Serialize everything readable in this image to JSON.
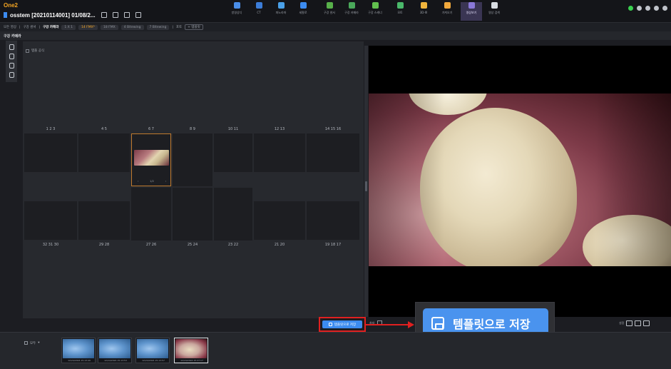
{
  "app": {
    "brand": "One2"
  },
  "patient": {
    "header": "osstem [20210114001] 01/08/2..."
  },
  "nav": [
    {
      "label": "방영상디",
      "color": "#4a8ee8"
    },
    {
      "label": "CT",
      "color": "#3c7dd8"
    },
    {
      "label": "파노라마",
      "color": "#4aa0e8"
    },
    {
      "label": "세팔로",
      "color": "#3c8cf0"
    },
    {
      "label": "구강 센서",
      "color": "#58b04a"
    },
    {
      "label": "구강 카메라",
      "color": "#4aa85a"
    },
    {
      "label": "구강 스캐너",
      "color": "#62c04e"
    },
    {
      "label": "모토",
      "color": "#4ab86a"
    },
    {
      "label": "3D-III",
      "color": "#f0b43c"
    },
    {
      "label": "가져오기",
      "color": "#f0a83c"
    },
    {
      "label": "영상보기",
      "color": "#8a78d8"
    },
    {
      "label": "영상 검색",
      "color": "#d8dce2"
    }
  ],
  "breadcrumb": {
    "all": "모든 영상",
    "sep1": "|",
    "sensor": "구강 센서",
    "sep2": "|",
    "current": "구강 카메라",
    "options": [
      "1 X 1",
      "14 FMX*",
      "18 FMX",
      "4 Bitewing",
      "7 Bitewing"
    ],
    "pipe": "|",
    "extra": "포토",
    "more": "+ 템플릿"
  },
  "section": {
    "title": "구강 카메라"
  },
  "template": {
    "checkbox_label": "템플 공식",
    "upper_numbers": [
      "1 2 3",
      "4 5",
      "6 7",
      "8 9",
      "10 11",
      "12 13",
      "14 15 16"
    ],
    "lower_numbers": [
      "32 31 30",
      "29 28",
      "27 26",
      "25 24",
      "23 22",
      "21 20",
      "19 18 17"
    ],
    "thumb_nav": {
      "prev": "‹",
      "page": "1/2",
      "next": "›"
    }
  },
  "save_template": {
    "small_label": "템플릿으로 저장",
    "big_label": "템플릿으로 저장"
  },
  "viewer_controls": {
    "label": "최대"
  },
  "right_tools": {
    "label": "설정"
  },
  "filmstrip": {
    "filter_label": "모두",
    "items": [
      {
        "caption": "12/24/2024 15:13:49",
        "kind": "xray"
      },
      {
        "caption": "12/24/2024 15:13:53",
        "kind": "xray"
      },
      {
        "caption": "12/24/2024 15:13:57",
        "kind": "xray"
      },
      {
        "caption": "12/24/2024 15:27:17",
        "kind": "photo"
      }
    ]
  }
}
